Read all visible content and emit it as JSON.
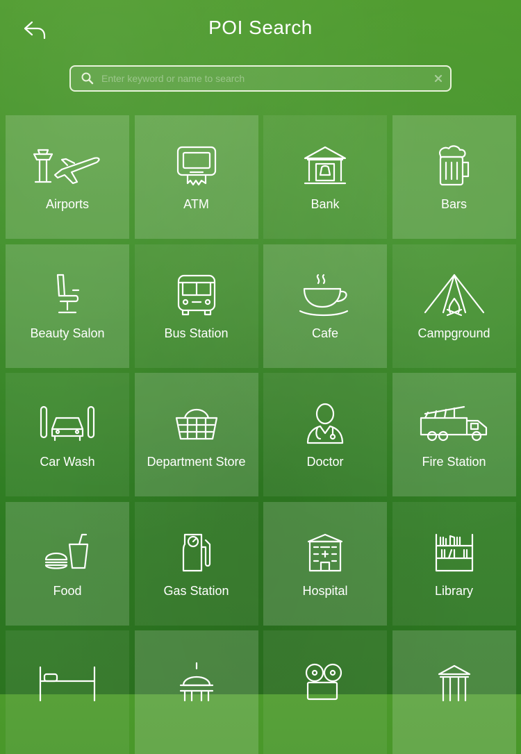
{
  "header": {
    "title": "POI Search",
    "back_icon": "back-arrow-icon"
  },
  "search": {
    "placeholder": "Enter keyword or name to search",
    "value": "",
    "icon": "search-icon",
    "clear_icon": "close-icon"
  },
  "categories": [
    {
      "label": "Airports",
      "icon": "airport-icon"
    },
    {
      "label": "ATM",
      "icon": "atm-icon"
    },
    {
      "label": "Bank",
      "icon": "bank-icon"
    },
    {
      "label": "Bars",
      "icon": "beer-mug-icon"
    },
    {
      "label": "Beauty Salon",
      "icon": "salon-chair-icon"
    },
    {
      "label": "Bus Station",
      "icon": "bus-icon"
    },
    {
      "label": "Cafe",
      "icon": "coffee-cup-icon"
    },
    {
      "label": "Campground",
      "icon": "tent-icon"
    },
    {
      "label": "Car Wash",
      "icon": "car-wash-icon"
    },
    {
      "label": "Department Store",
      "icon": "basket-icon"
    },
    {
      "label": "Doctor",
      "icon": "doctor-icon"
    },
    {
      "label": "Fire Station",
      "icon": "fire-truck-icon"
    },
    {
      "label": "Food",
      "icon": "burger-drink-icon"
    },
    {
      "label": "Gas Station",
      "icon": "gas-pump-icon"
    },
    {
      "label": "Hospital",
      "icon": "hospital-icon"
    },
    {
      "label": "Library",
      "icon": "bookshelf-icon"
    },
    {
      "label": "",
      "icon": "bed-icon"
    },
    {
      "label": "",
      "icon": "capitol-dome-icon"
    },
    {
      "label": "",
      "icon": "film-camera-icon"
    },
    {
      "label": "",
      "icon": "museum-icon"
    }
  ],
  "colors": {
    "background_top": "#4c9a2b",
    "background_bottom": "#2b7320",
    "text": "#ffffff"
  }
}
